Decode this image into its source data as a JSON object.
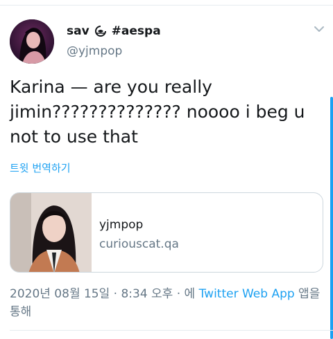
{
  "tweet": {
    "display_name": "sav",
    "name_suffix": "#aespa",
    "handle": "@yjmpop",
    "text": "Karina — are you really jimin?????????????? noooo i beg u not to use that",
    "translate_label": "트윗 번역하기",
    "card": {
      "title": "yjmpop",
      "domain": "curiouscat.qa"
    },
    "meta": {
      "prefix": "2020년 08월 15일 · 8:34 오후 · 에 ",
      "app": "Twitter Web App",
      "suffix": " 앱을 통해"
    }
  },
  "colors": {
    "link": "#1da1f2",
    "secondary_text": "#657786",
    "primary_text": "#14171a",
    "border": "#ccd6dd"
  },
  "icons": {
    "chevron": "chevron-down-icon",
    "emblem": "aespa-emblem-icon"
  }
}
